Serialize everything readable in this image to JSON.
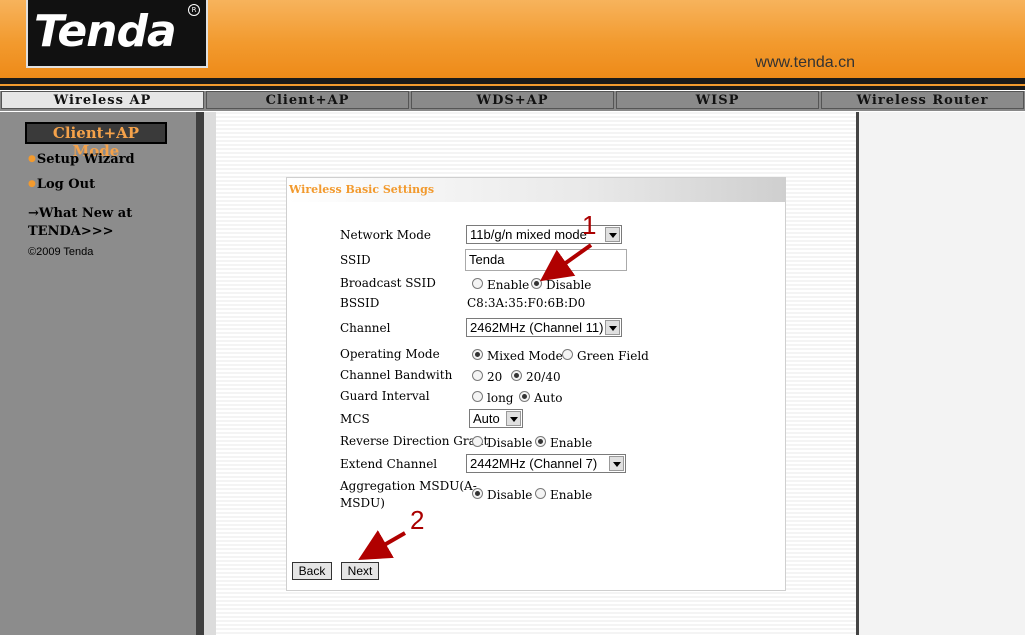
{
  "header": {
    "logo_text": "Tenda",
    "logo_reg": "R",
    "url": "www.tenda.cn"
  },
  "tabs": [
    {
      "label": "Wireless AP",
      "active": true
    },
    {
      "label": "Client+AP",
      "active": false
    },
    {
      "label": "WDS+AP",
      "active": false
    },
    {
      "label": "WISP",
      "active": false
    },
    {
      "label": "Wireless Router",
      "active": false
    }
  ],
  "sidebar": {
    "mode_label": "Client+AP Mode",
    "setup_wizard": "Setup Wizard",
    "log_out": "Log Out",
    "whats_new_line1": "→What New at",
    "whats_new_line2": "TENDA>>>",
    "copyright": "©2009 Tenda"
  },
  "panel": {
    "title": "Wireless Basic Settings",
    "network_mode": {
      "label": "Network Mode",
      "value": "11b/g/n mixed mode"
    },
    "ssid": {
      "label": "SSID",
      "value": "Tenda"
    },
    "broadcast_ssid": {
      "label": "Broadcast SSID",
      "option1": "Enable",
      "option2": "Disable",
      "selected": "Disable"
    },
    "bssid": {
      "label": "BSSID",
      "value": "C8:3A:35:F0:6B:D0"
    },
    "channel": {
      "label": "Channel",
      "value": "2462MHz (Channel 11)"
    },
    "operating_mode": {
      "label": "Operating Mode",
      "option1": "Mixed Mode",
      "option2": "Green Field",
      "selected": "Mixed Mode"
    },
    "channel_bandwidth": {
      "label": "Channel Bandwith",
      "option1": "20",
      "option2": "20/40",
      "selected": "20/40"
    },
    "guard_interval": {
      "label": "Guard Interval",
      "option1": "long",
      "option2": "Auto",
      "selected": "Auto"
    },
    "mcs": {
      "label": "MCS",
      "value": "Auto"
    },
    "reverse_direction_grant": {
      "label": "Reverse Direction Grant",
      "option1": "Disable",
      "option2": "Enable",
      "selected": "Enable"
    },
    "extend_channel": {
      "label": "Extend Channel",
      "value": "2442MHz (Channel 7)"
    },
    "aggregation_msdu": {
      "label_line1": "Aggregation MSDU(A-",
      "label_line2": "MSDU)",
      "option1": "Disable",
      "option2": "Enable",
      "selected": "Disable"
    },
    "back_button": "Back",
    "next_button": "Next"
  },
  "annotations": {
    "marker1": "1",
    "marker2": "2",
    "arrow_color": "#b00000"
  },
  "colors": {
    "accent_orange": "#f29a2e",
    "header_dark": "#1a1a1a",
    "sidebar_gray": "#8c8c8c"
  }
}
